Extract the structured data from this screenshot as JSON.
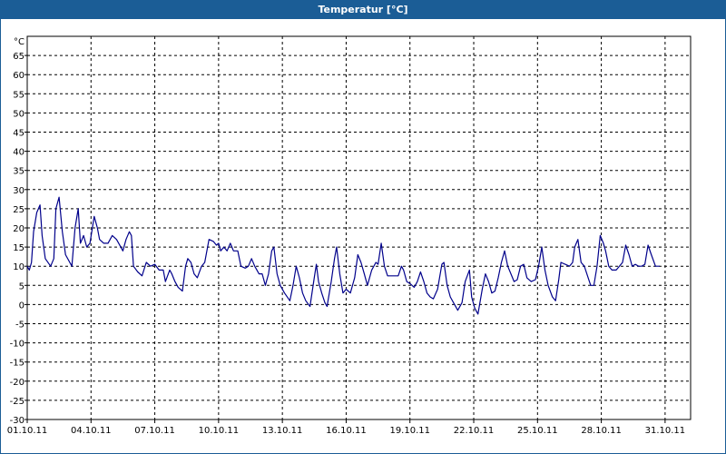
{
  "window": {
    "title": "Temperatur [°C]"
  },
  "colors": {
    "titlebar": "#1b5d96",
    "line": "#00008b",
    "grid": "#000000"
  },
  "chart_data": {
    "type": "line",
    "title": "Temperatur [°C]",
    "unit_label": "°C",
    "xlabel": "",
    "ylabel": "",
    "ylim": [
      -30,
      70
    ],
    "y_ticks": [
      65,
      60,
      55,
      50,
      45,
      40,
      35,
      30,
      25,
      20,
      15,
      10,
      5,
      0,
      -5,
      -10,
      -15,
      -20,
      -25,
      -30
    ],
    "xlim_days": [
      0,
      31.2
    ],
    "x_ticks": [
      {
        "label": "01.10.11",
        "day": 0
      },
      {
        "label": "04.10.11",
        "day": 3
      },
      {
        "label": "07.10.11",
        "day": 6
      },
      {
        "label": "10.10.11",
        "day": 9
      },
      {
        "label": "13.10.11",
        "day": 12
      },
      {
        "label": "16.10.11",
        "day": 15
      },
      {
        "label": "19.10.11",
        "day": 18
      },
      {
        "label": "22.10.11",
        "day": 21
      },
      {
        "label": "25.10.11",
        "day": 24
      },
      {
        "label": "28.10.11",
        "day": 27
      },
      {
        "label": "31.10.11",
        "day": 30
      }
    ],
    "grid": true,
    "legend": "none",
    "series": [
      {
        "points": [
          [
            0.0,
            10
          ],
          [
            0.1,
            9
          ],
          [
            0.2,
            11
          ],
          [
            0.3,
            19
          ],
          [
            0.45,
            24
          ],
          [
            0.6,
            26
          ],
          [
            0.7,
            18
          ],
          [
            0.85,
            12
          ],
          [
            1.1,
            10
          ],
          [
            1.25,
            12
          ],
          [
            1.35,
            25
          ],
          [
            1.5,
            28
          ],
          [
            1.65,
            19
          ],
          [
            1.8,
            13
          ],
          [
            2.1,
            10
          ],
          [
            2.25,
            20
          ],
          [
            2.4,
            25
          ],
          [
            2.5,
            16
          ],
          [
            2.65,
            18
          ],
          [
            2.8,
            15
          ],
          [
            2.95,
            16
          ],
          [
            3.15,
            23
          ],
          [
            3.3,
            20
          ],
          [
            3.4,
            17
          ],
          [
            3.6,
            16
          ],
          [
            3.8,
            16
          ],
          [
            4.0,
            18
          ],
          [
            4.2,
            17
          ],
          [
            4.4,
            15
          ],
          [
            4.5,
            14
          ],
          [
            4.65,
            17
          ],
          [
            4.8,
            19
          ],
          [
            4.9,
            18
          ],
          [
            5.0,
            10
          ],
          [
            5.2,
            8.5
          ],
          [
            5.4,
            7.5
          ],
          [
            5.6,
            11
          ],
          [
            5.8,
            10
          ],
          [
            6.0,
            10.5
          ],
          [
            6.2,
            9
          ],
          [
            6.4,
            9
          ],
          [
            6.5,
            6
          ],
          [
            6.7,
            9
          ],
          [
            6.8,
            8
          ],
          [
            6.95,
            6
          ],
          [
            7.1,
            4.5
          ],
          [
            7.3,
            3.5
          ],
          [
            7.45,
            10
          ],
          [
            7.55,
            12
          ],
          [
            7.7,
            11
          ],
          [
            7.85,
            8
          ],
          [
            8.0,
            7
          ],
          [
            8.2,
            10
          ],
          [
            8.35,
            11
          ],
          [
            8.55,
            17
          ],
          [
            8.75,
            16.5
          ],
          [
            8.9,
            15.5
          ],
          [
            9.0,
            16
          ],
          [
            9.1,
            14
          ],
          [
            9.25,
            15
          ],
          [
            9.4,
            14
          ],
          [
            9.55,
            16
          ],
          [
            9.7,
            14
          ],
          [
            9.9,
            14
          ],
          [
            10.05,
            10
          ],
          [
            10.25,
            9.5
          ],
          [
            10.4,
            10
          ],
          [
            10.55,
            12
          ],
          [
            10.7,
            10
          ],
          [
            10.9,
            8
          ],
          [
            11.05,
            8
          ],
          [
            11.2,
            5
          ],
          [
            11.35,
            8
          ],
          [
            11.5,
            14
          ],
          [
            11.6,
            15
          ],
          [
            11.75,
            8
          ],
          [
            11.9,
            5
          ],
          [
            12.1,
            3
          ],
          [
            12.35,
            1
          ],
          [
            12.5,
            5
          ],
          [
            12.65,
            10
          ],
          [
            12.8,
            7
          ],
          [
            12.95,
            3
          ],
          [
            13.1,
            1
          ],
          [
            13.3,
            -0.5
          ],
          [
            13.5,
            7
          ],
          [
            13.6,
            10.5
          ],
          [
            13.7,
            6
          ],
          [
            13.85,
            3
          ],
          [
            14.0,
            0.5
          ],
          [
            14.1,
            -0.5
          ],
          [
            14.3,
            6
          ],
          [
            14.45,
            12
          ],
          [
            14.55,
            15
          ],
          [
            14.7,
            8
          ],
          [
            14.85,
            3
          ],
          [
            15.0,
            4
          ],
          [
            15.2,
            3
          ],
          [
            15.4,
            7
          ],
          [
            15.55,
            13
          ],
          [
            15.7,
            11
          ],
          [
            15.85,
            8
          ],
          [
            16.0,
            5
          ],
          [
            16.2,
            9
          ],
          [
            16.4,
            11
          ],
          [
            16.5,
            10.5
          ],
          [
            16.65,
            16
          ],
          [
            16.8,
            10
          ],
          [
            16.95,
            7.5
          ],
          [
            17.2,
            7.5
          ],
          [
            17.45,
            7.5
          ],
          [
            17.6,
            10
          ],
          [
            17.7,
            9
          ],
          [
            17.85,
            6
          ],
          [
            18.0,
            5.5
          ],
          [
            18.2,
            4.5
          ],
          [
            18.35,
            6
          ],
          [
            18.5,
            8.5
          ],
          [
            18.65,
            6
          ],
          [
            18.8,
            3
          ],
          [
            18.95,
            2
          ],
          [
            19.1,
            1.5
          ],
          [
            19.3,
            4
          ],
          [
            19.5,
            10.5
          ],
          [
            19.6,
            11
          ],
          [
            19.75,
            5
          ],
          [
            19.9,
            2
          ],
          [
            20.1,
            0
          ],
          [
            20.25,
            -1.5
          ],
          [
            20.45,
            0.5
          ],
          [
            20.6,
            6
          ],
          [
            20.8,
            9
          ],
          [
            20.9,
            2
          ],
          [
            21.05,
            -1
          ],
          [
            21.2,
            -2.5
          ],
          [
            21.4,
            4
          ],
          [
            21.55,
            8
          ],
          [
            21.7,
            6
          ],
          [
            21.85,
            3
          ],
          [
            22.0,
            3.5
          ],
          [
            22.15,
            7
          ],
          [
            22.3,
            11
          ],
          [
            22.45,
            14
          ],
          [
            22.6,
            10
          ],
          [
            22.75,
            8
          ],
          [
            22.9,
            6
          ],
          [
            23.05,
            6.5
          ],
          [
            23.2,
            10
          ],
          [
            23.35,
            10.5
          ],
          [
            23.5,
            7
          ],
          [
            23.7,
            6
          ],
          [
            23.9,
            6.5
          ],
          [
            24.05,
            10
          ],
          [
            24.2,
            15
          ],
          [
            24.35,
            9
          ],
          [
            24.5,
            5
          ],
          [
            24.7,
            2
          ],
          [
            24.85,
            1
          ],
          [
            25.0,
            6.5
          ],
          [
            25.1,
            11
          ],
          [
            25.3,
            10.5
          ],
          [
            25.5,
            10
          ],
          [
            25.65,
            11
          ],
          [
            25.75,
            15
          ],
          [
            25.9,
            17
          ],
          [
            26.05,
            11
          ],
          [
            26.2,
            10
          ],
          [
            26.35,
            7.5
          ],
          [
            26.5,
            5
          ],
          [
            26.65,
            5
          ],
          [
            26.8,
            10
          ],
          [
            26.95,
            18
          ],
          [
            27.1,
            16
          ],
          [
            27.2,
            14
          ],
          [
            27.35,
            10
          ],
          [
            27.5,
            9
          ],
          [
            27.7,
            9
          ],
          [
            27.85,
            10
          ],
          [
            28.0,
            11
          ],
          [
            28.15,
            15.5
          ],
          [
            28.3,
            13
          ],
          [
            28.45,
            10
          ],
          [
            28.6,
            10.5
          ],
          [
            28.75,
            10
          ],
          [
            28.9,
            10
          ],
          [
            29.05,
            10.5
          ],
          [
            29.2,
            15.5
          ],
          [
            29.35,
            13
          ],
          [
            29.55,
            10
          ],
          [
            29.75,
            10
          ]
        ]
      }
    ]
  }
}
